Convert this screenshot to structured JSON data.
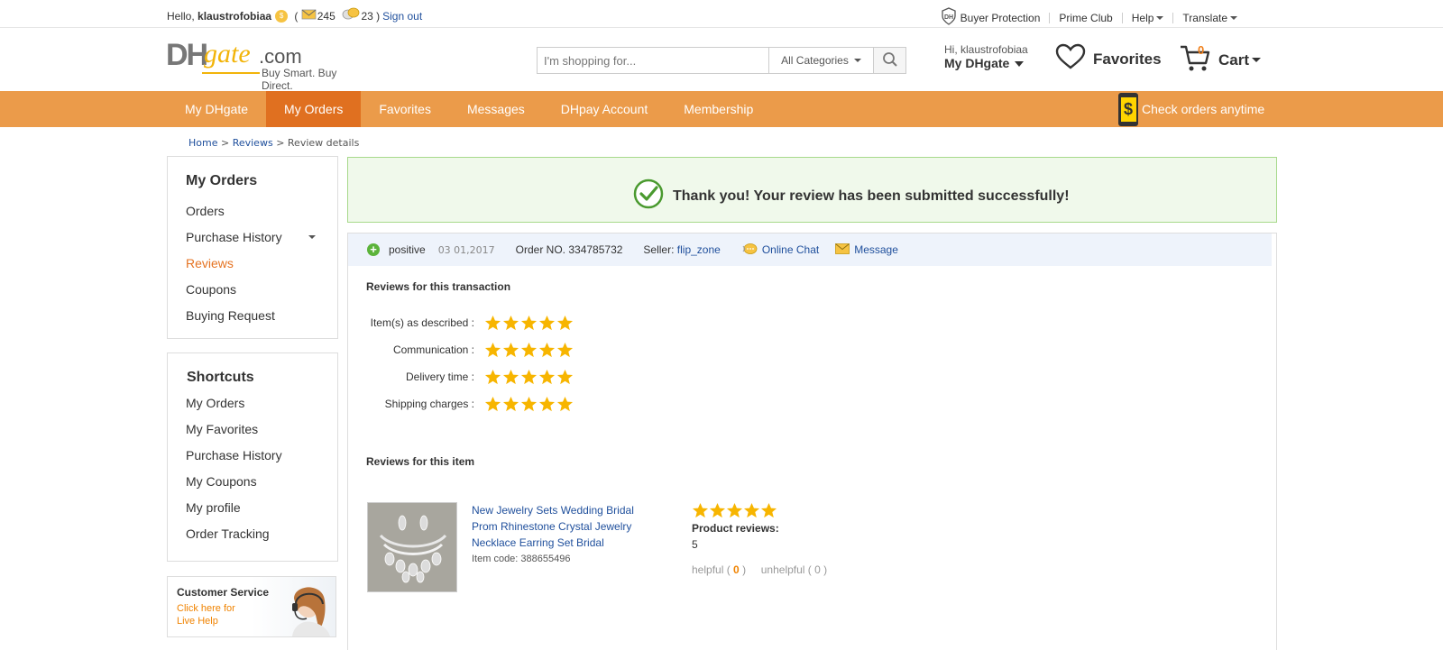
{
  "topbar": {
    "greeting": "Hello,",
    "username": "klaustrofobiaa",
    "paren_open": "(",
    "mail_count": "245",
    "chat_count": "23 )",
    "sign_out": "Sign out",
    "buyer_protection": "Buyer Protection",
    "prime_club": "Prime Club",
    "help": "Help",
    "translate": "Translate"
  },
  "header": {
    "logo_dh": "DH",
    "logo_gate": "gate",
    "logo_com": ".com",
    "logo_tagline": "Buy Smart. Buy Direct.",
    "search_placeholder": "I'm shopping for...",
    "category": "All Categories",
    "hi_user": "Hi, klaustrofobiaa",
    "my_dhgate": "My DHgate",
    "favorites": "Favorites",
    "cart_count": "0",
    "cart": "Cart"
  },
  "nav": {
    "items": [
      "My DHgate",
      "My Orders",
      "Favorites",
      "Messages",
      "DHpay Account",
      "Membership"
    ],
    "active": "My Orders",
    "check_orders": "Check orders anytime",
    "phone_symbol": "$"
  },
  "breadcrumb": {
    "home": "Home",
    "sep": ">",
    "reviews": "Reviews",
    "current": "Review details"
  },
  "sidebar": {
    "orders_title": "My Orders",
    "orders_links": [
      "Orders",
      "Purchase History",
      "Reviews",
      "Coupons",
      "Buying Request"
    ],
    "active_link": "Reviews",
    "shortcuts_title": "Shortcuts",
    "shortcut_links": [
      "My Orders",
      "My Favorites",
      "Purchase History",
      "My Coupons",
      "My profile",
      "Order Tracking"
    ],
    "cs_title": "Customer Service",
    "cs_link_1": "Click here for",
    "cs_link_2": "Live Help"
  },
  "success": {
    "message": "Thank you! Your review has been submitted successfully!"
  },
  "review": {
    "type": "positive",
    "date": "03 01,2017",
    "order_label": "Order NO. 334785732",
    "seller_label": "Seller:",
    "seller_name": "flip_zone",
    "online_chat": "Online Chat",
    "message": "Message",
    "transaction_title": "Reviews for this transaction",
    "ratings": [
      {
        "label": "Item(s) as described :",
        "stars": 5
      },
      {
        "label": "Communication :",
        "stars": 5
      },
      {
        "label": "Delivery time :",
        "stars": 5
      },
      {
        "label": "Shipping charges :",
        "stars": 5
      }
    ],
    "item_title": "Reviews for this item",
    "product_name": "New Jewelry Sets Wedding Bridal Prom Rhinestone Crystal Jewelry Necklace Earring Set Bridal",
    "item_code": "Item code: 388655496",
    "product_stars": 5,
    "product_reviews_label": "Product reviews:",
    "product_reviews_value": "5",
    "helpful_label": "helpful (",
    "helpful_count": "0",
    "helpful_close": ")",
    "unhelpful": "unhelpful ( 0 )"
  },
  "colors": {
    "nav_bg": "#eb9b4a",
    "nav_active": "#e07020",
    "link": "#1f4f9c",
    "accent": "#e57322",
    "star": "#f7b500",
    "success_bg": "#f0f9eb"
  }
}
